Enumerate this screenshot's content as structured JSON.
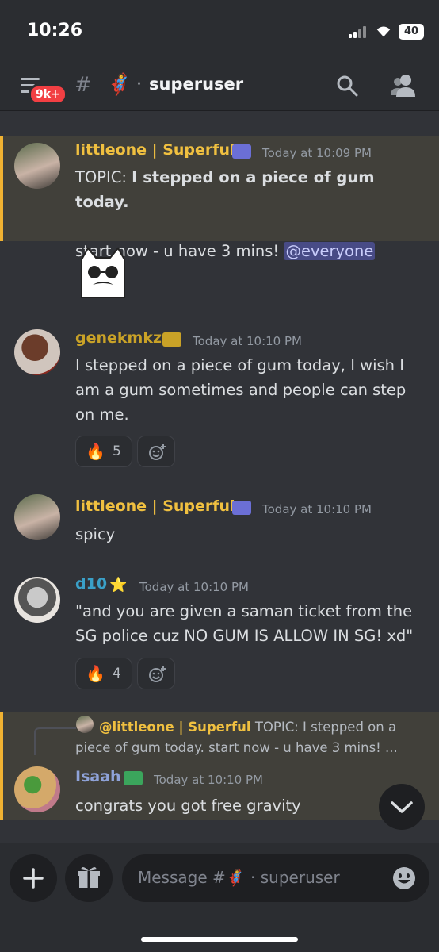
{
  "status_bar": {
    "time": "10:26",
    "battery": "40"
  },
  "header": {
    "unread_badge": "9k+",
    "channel_emoji": "🦸",
    "channel_separator": "·",
    "channel_name": "superuser"
  },
  "messages": [
    {
      "username": "littleone | Superful",
      "name_color": "#f0c040",
      "timestamp": "Today at 10:09 PM",
      "text_prefix": "TOPIC: ",
      "text_bold": "I stepped on a piece of gum today.",
      "text_line2": "start now -  u have 3 mins! ",
      "mention": "@everyone",
      "highlighted": true
    },
    {
      "username": "genekmkz",
      "name_color": "#c9a227",
      "timestamp": "Today at 10:10 PM",
      "text": "I stepped on a piece of gum today, I wish I am a gum sometimes and people can step on me.",
      "reaction": {
        "emoji": "🔥",
        "count": "5"
      }
    },
    {
      "username": "littleone | Superful",
      "name_color": "#f0c040",
      "timestamp": "Today at 10:10 PM",
      "text": "spicy"
    },
    {
      "username": "d10",
      "name_color": "#3aa0c8",
      "badge_emoji": "⭐",
      "timestamp": "Today at 10:10 PM",
      "text": "\"and you are given a saman ticket from the SG police cuz NO GUM IS ALLOW IN SG! xd\"",
      "reaction": {
        "emoji": "🔥",
        "count": "4"
      }
    },
    {
      "reply_to_name": "@littleone | Superful",
      "reply_to_text": "TOPIC: I stepped on a piece of gum today.  start now -  u have 3 mins! ...",
      "username": "Isaah",
      "name_color": "#8fa3d9",
      "timestamp": "Today at 10:10 PM",
      "text": "congrats you got free gravity",
      "highlighted": true
    }
  ],
  "composer": {
    "placeholder_prefix": "Message #",
    "placeholder_emoji": "🦸",
    "placeholder_sep": "·",
    "placeholder_channel": "superuser"
  },
  "icons": {
    "menu": "hamburger-icon",
    "channel": "locked-hash-icon",
    "search": "search-icon",
    "members": "members-icon",
    "add": "plus-icon",
    "gift": "gift-icon",
    "emoji": "emoji-icon",
    "scroll": "chevron-down-icon"
  }
}
